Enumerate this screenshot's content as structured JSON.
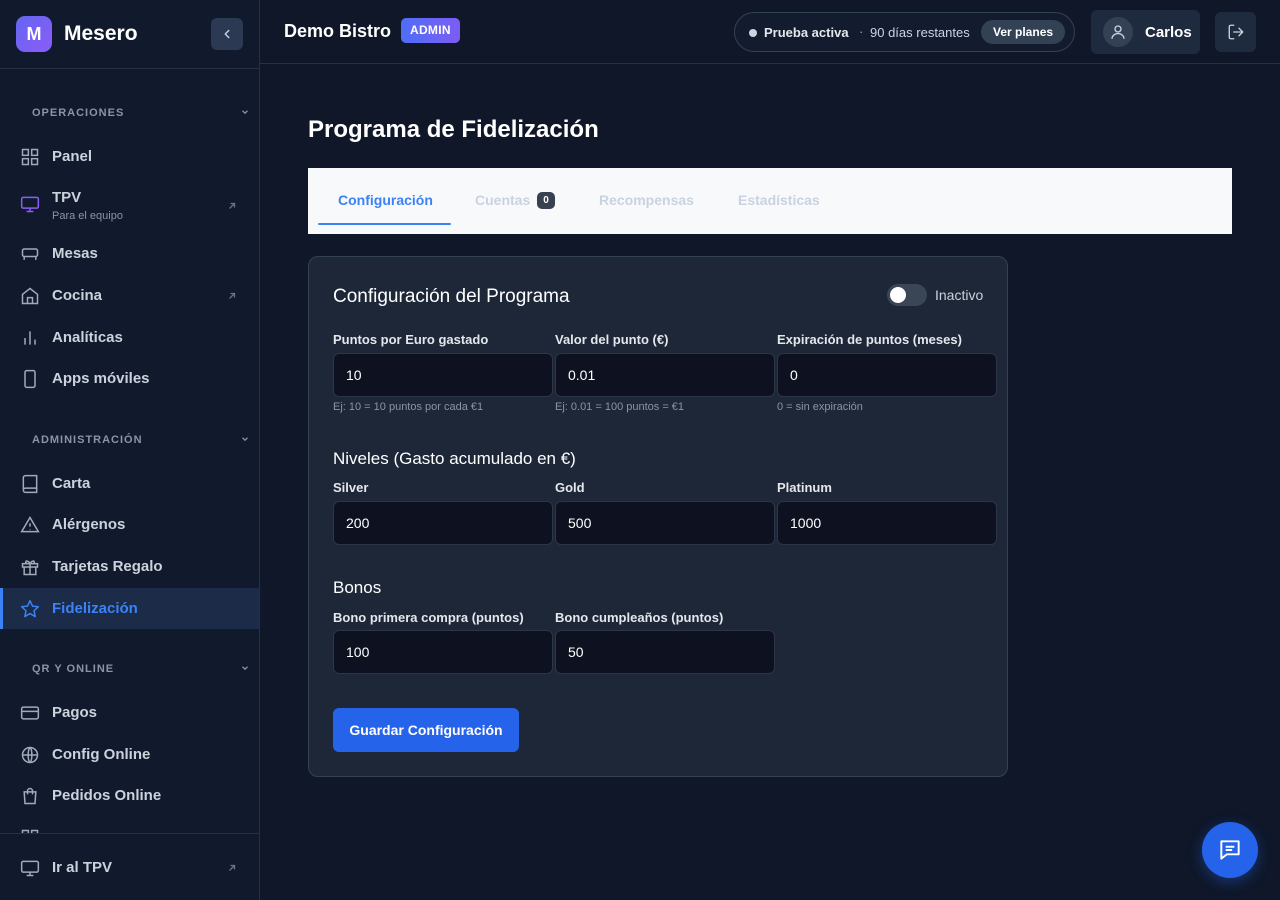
{
  "brand": {
    "logo_letter": "M",
    "name": "Mesero"
  },
  "sidebar": {
    "sections": [
      {
        "title": "OPERACIONES"
      },
      {
        "title": "ADMINISTRACIÓN"
      },
      {
        "title": "QR Y ONLINE"
      }
    ],
    "items": [
      {
        "label": "Panel",
        "icon": "grid-icon"
      },
      {
        "label": "TPV",
        "sublabel": "Para el equipo",
        "icon": "monitor-icon"
      },
      {
        "label": "Mesas",
        "icon": "table-icon"
      },
      {
        "label": "Cocina",
        "icon": "home-icon"
      },
      {
        "label": "Analíticas",
        "icon": "bar-chart-icon"
      },
      {
        "label": "Apps móviles",
        "icon": "phone-icon"
      },
      {
        "label": "Carta",
        "icon": "book-icon"
      },
      {
        "label": "Alérgenos",
        "icon": "warning-icon"
      },
      {
        "label": "Tarjetas Regalo",
        "icon": "gift-icon"
      },
      {
        "label": "Fidelización",
        "icon": "star-icon",
        "active": true
      },
      {
        "label": "Pagos",
        "icon": "credit-card-icon"
      },
      {
        "label": "Config Online",
        "icon": "globe-icon"
      },
      {
        "label": "Pedidos Online",
        "icon": "shopping-bag-icon"
      }
    ],
    "footer_item": {
      "label": "Ir al TPV",
      "icon": "monitor-icon"
    }
  },
  "topbar": {
    "org_name": "Demo Bistro",
    "role_badge": "ADMIN",
    "trial_status": "Prueba activa",
    "trial_separator": "·",
    "trial_remaining": "90 días restantes",
    "plans_button": "Ver planes",
    "user_name": "Carlos"
  },
  "main": {
    "title": "Programa de Fidelización",
    "tabs": [
      {
        "label": "Configuración",
        "active": true
      },
      {
        "label": "Cuentas",
        "badge": "0"
      },
      {
        "label": "Recompensas"
      },
      {
        "label": "Estadísticas"
      }
    ],
    "card": {
      "title": "Configuración del Programa",
      "toggle_label": "Inactivo",
      "toggle_on": false,
      "fields": [
        {
          "label": "Puntos por Euro gastado",
          "value": "10",
          "hint": "Ej: 10 = 10 puntos por cada €1"
        },
        {
          "label": "Valor del punto (€)",
          "value": "0.01",
          "hint": "Ej: 0.01 = 100 puntos = €1"
        },
        {
          "label": "Expiración de puntos (meses)",
          "value": "0",
          "hint": "0 = sin expiración"
        }
      ],
      "levels_title": "Niveles (Gasto acumulado en €)",
      "levels": [
        {
          "label": "Silver",
          "value": "200"
        },
        {
          "label": "Gold",
          "value": "500"
        },
        {
          "label": "Platinum",
          "value": "1000"
        }
      ],
      "bonus_title": "Bonos",
      "bonuses": [
        {
          "label": "Bono primera compra (puntos)",
          "value": "100"
        },
        {
          "label": "Bono cumpleaños (puntos)",
          "value": "50"
        }
      ],
      "save_button": "Guardar Configuración"
    }
  },
  "colors": {
    "accent": "#3b82f6",
    "primary_button": "#2563eb",
    "background": "#0f1729"
  }
}
